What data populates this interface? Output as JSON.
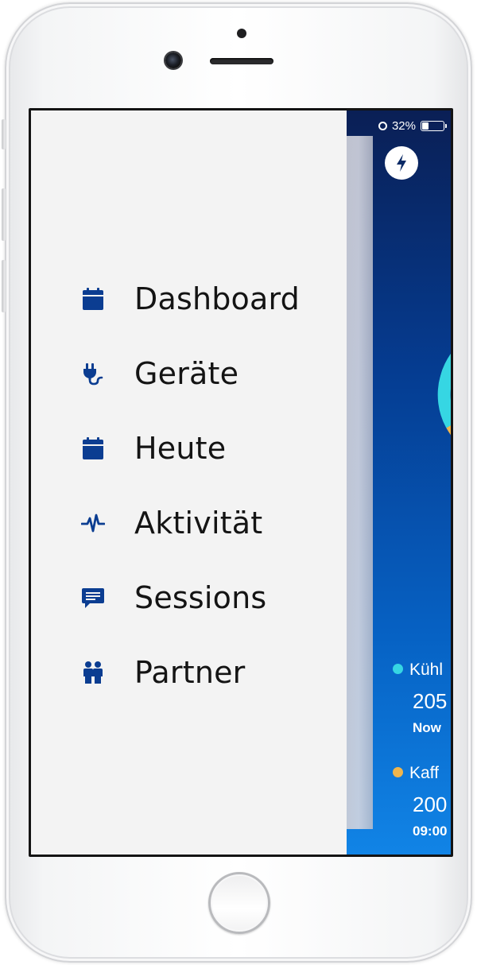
{
  "status_bar": {
    "battery_percent": "32%",
    "battery_level": 0.32
  },
  "drawer": {
    "items": [
      {
        "label": "Dashboard",
        "icon": "calendar-icon"
      },
      {
        "label": "Geräte",
        "icon": "plug-icon"
      },
      {
        "label": "Heute",
        "icon": "calendar-icon"
      },
      {
        "label": "Aktivität",
        "icon": "pulse-icon"
      },
      {
        "label": "Sessions",
        "icon": "chat-icon"
      },
      {
        "label": "Partner",
        "icon": "people-icon"
      }
    ]
  },
  "background_app": {
    "devices": [
      {
        "name": "Kühl",
        "value": "205",
        "time": "Now",
        "color": "#36d6e3"
      },
      {
        "name": "Kaff",
        "value": "200",
        "time": "09:00",
        "color": "#f0b54c"
      }
    ]
  },
  "colors": {
    "accent": "#0b3d91",
    "drawer_bg": "#f3f3f3",
    "app_bg_top": "#0a1f55",
    "app_bg_bottom": "#1184e6"
  }
}
